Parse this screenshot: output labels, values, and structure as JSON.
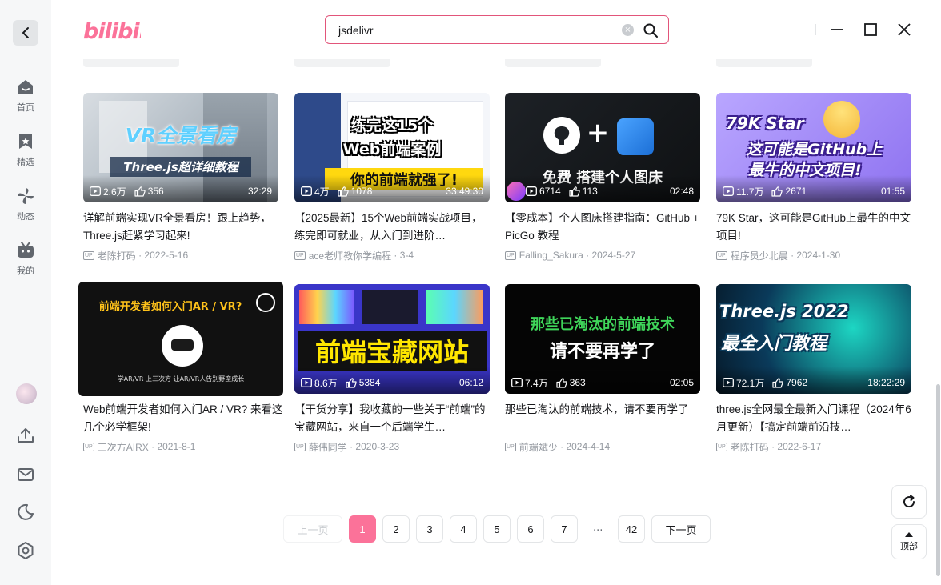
{
  "app": {
    "logo_text": "bilibili"
  },
  "sidebar": {
    "items": [
      {
        "label": "首页",
        "icon": "home-icon"
      },
      {
        "label": "精选",
        "icon": "bookmark-icon"
      },
      {
        "label": "动态",
        "icon": "pinwheel-icon"
      },
      {
        "label": "我的",
        "icon": "tv-icon"
      }
    ],
    "bottom_icons": [
      "avatar",
      "upload-icon",
      "mail-icon",
      "moon-icon",
      "settings-icon"
    ]
  },
  "search": {
    "value": "jsdelivr"
  },
  "videos": [
    {
      "views": "2.6万",
      "likes": "356",
      "duration": "32:29",
      "title": "详解前端实现VR全景看房！跟上趋势，Three.js赶紧学习起来!",
      "author": "老陈打码",
      "date": "2022-5-16",
      "thumb_lines": [
        "VR全景看房",
        "Three.js超详细教程"
      ]
    },
    {
      "views": "4万",
      "likes": "1078",
      "duration": "33:49:30",
      "title": "【2025最新】15个Web前端实战项目，练完即可就业，从入门到进阶…",
      "author": "ace老师教你学编程",
      "date": "3-4",
      "thumb_lines": [
        "练完这15个",
        "Web前端案例",
        "你的前端就强了!"
      ]
    },
    {
      "views": "6714",
      "likes": "113",
      "duration": "02:48",
      "title": "【零成本】个人图床搭建指南：GitHub + PicGo 教程",
      "author": "Falling_Sakura",
      "date": "2024-5-27",
      "thumb_lines": [
        "+",
        "免费 搭建个人图床"
      ]
    },
    {
      "views": "11.7万",
      "likes": "2671",
      "duration": "01:55",
      "title": "79K Star，这可能是GitHub上最牛的中文项目!",
      "author": "程序员少北晨",
      "date": "2024-1-30",
      "thumb_lines": [
        "79K Star",
        "这可能是GitHub上",
        "最牛的中文项目!"
      ]
    },
    {
      "views": "",
      "likes": "",
      "duration": "",
      "title": "Web前端开发者如何入门AR / VR? 来看这几个必学框架!",
      "author": "三次方AIRX",
      "date": "2021-8-1",
      "thumb_lines": [
        "前端开发者如何入门AR / VR?",
        "学AR/VR  上三次方  让AR/VR人告别野蛮成长"
      ]
    },
    {
      "views": "8.6万",
      "likes": "5384",
      "duration": "06:12",
      "title": "【干货分享】我收藏的一些关于“前端”的宝藏网站，来自一个后端学生…",
      "author": "薛伟同学",
      "date": "2020-3-23",
      "thumb_lines": [
        "前端宝藏网站"
      ]
    },
    {
      "views": "7.4万",
      "likes": "363",
      "duration": "02:05",
      "title": "那些已淘汰的前端技术，请不要再学了",
      "author": "前端斌少",
      "date": "2024-4-14",
      "thumb_lines": [
        "那些已淘汰的前端技术",
        "请不要再学了"
      ]
    },
    {
      "views": "72.1万",
      "likes": "7962",
      "duration": "18:22:29",
      "title": "three.js全网最全最新入门课程（2024年6月更新）【搞定前端前沿技…",
      "author": "老陈打码",
      "date": "2022-6-17",
      "thumb_lines": [
        "Three.js 2022",
        "最全入门教程"
      ]
    }
  ],
  "pagination": {
    "prev": "上一页",
    "next": "下一页",
    "pages": [
      "1",
      "2",
      "3",
      "4",
      "5",
      "6",
      "7"
    ],
    "ellipsis": "...",
    "last": "42",
    "current": "1"
  },
  "floating": {
    "refresh_icon": "refresh-icon",
    "top_label": "顶部"
  },
  "colors": {
    "brand_pink": "#fb7299",
    "search_border": "#e2557a"
  }
}
